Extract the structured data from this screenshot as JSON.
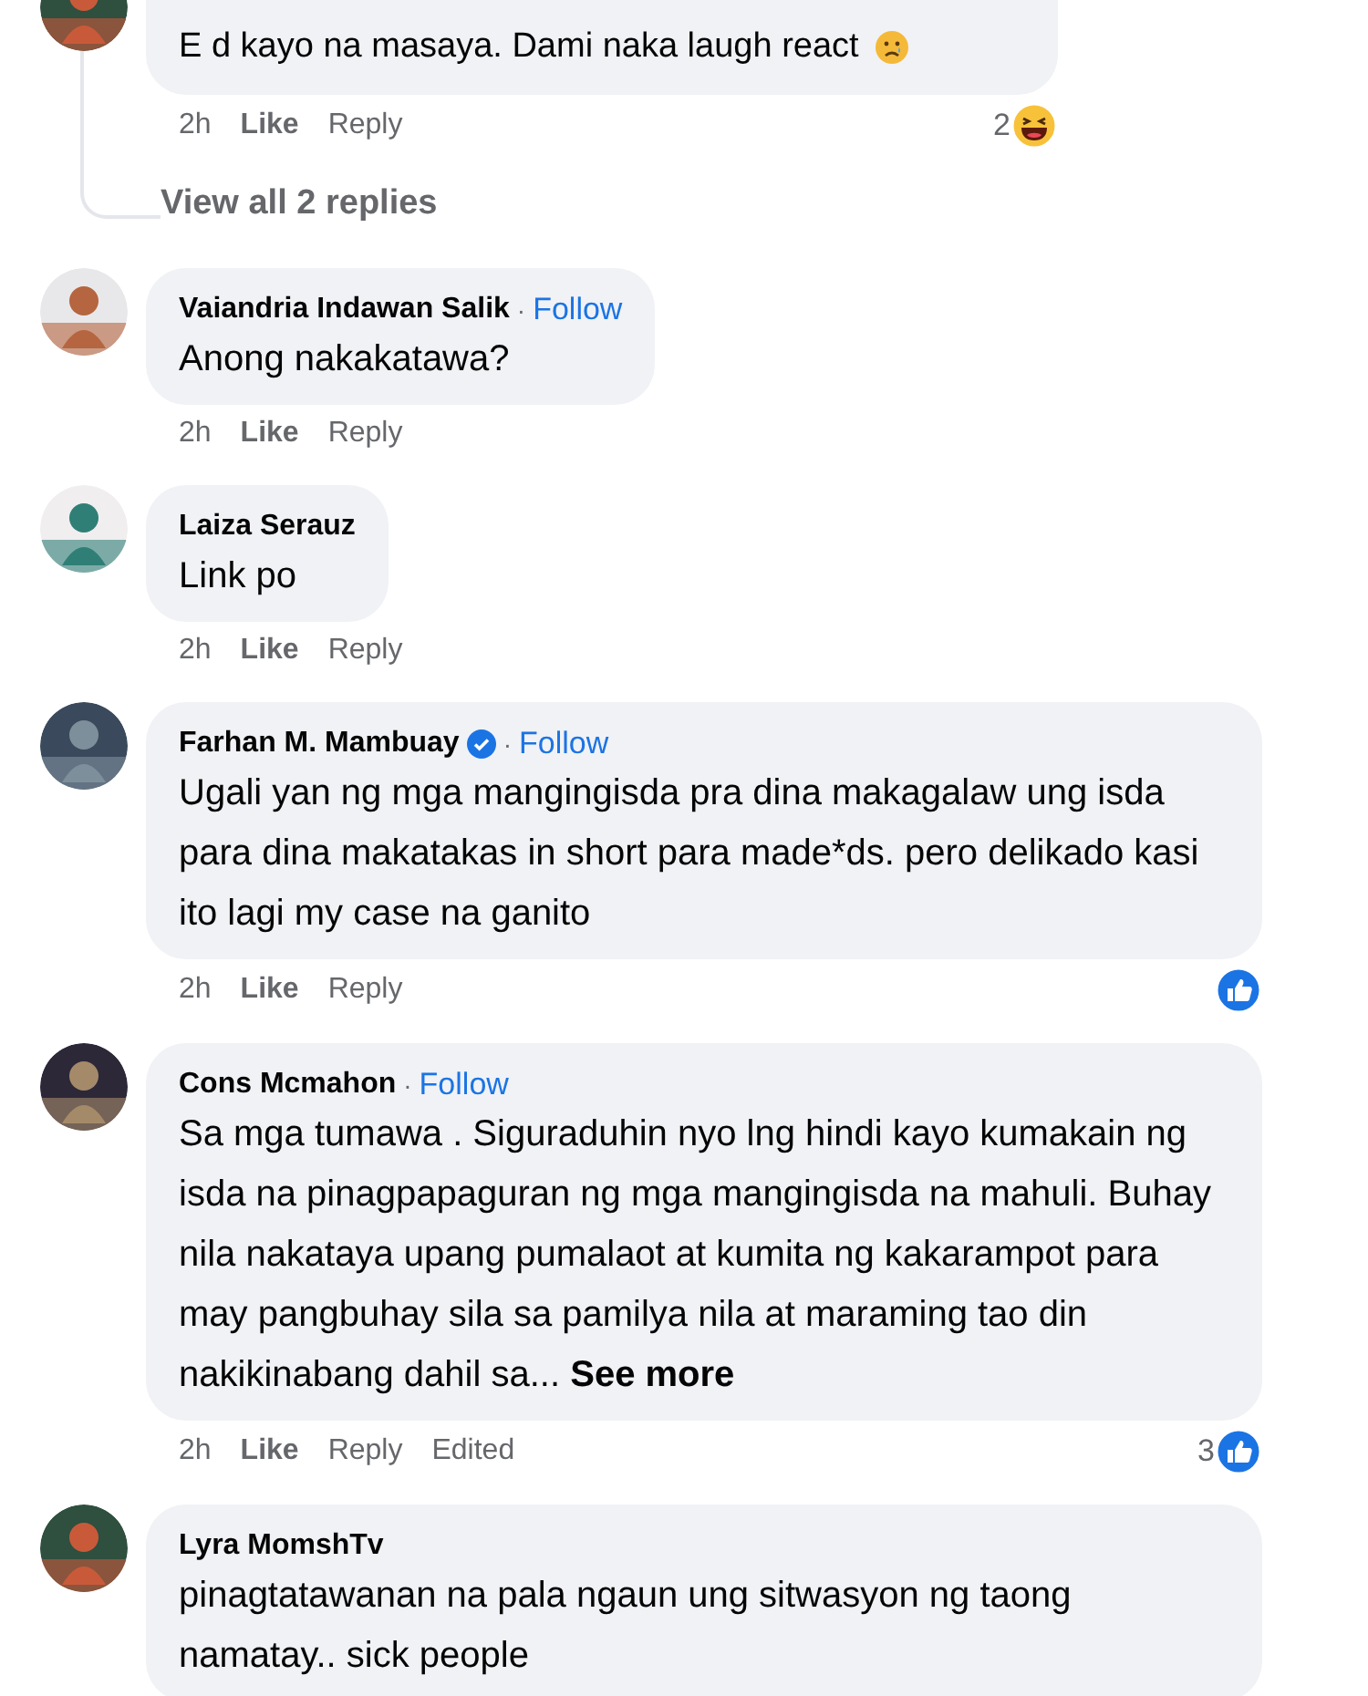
{
  "thread_reply": {
    "text": "E d kayo na masaya. Dami naka laugh react",
    "trailing_emoji": true,
    "time": "2h",
    "like": "Like",
    "reply": "Reply",
    "reaction": {
      "kind": "haha",
      "count": "2"
    }
  },
  "view_replies": "View all 2 replies",
  "comments": [
    {
      "name": "Vaiandria Indawan Salik",
      "verified": false,
      "separator": "·",
      "follow": "Follow",
      "text": "Anong nakakatawa?",
      "time": "2h",
      "like": "Like",
      "reply": "Reply"
    },
    {
      "name": "Laiza Serauz",
      "verified": false,
      "text": "Link po",
      "time": "2h",
      "like": "Like",
      "reply": "Reply"
    },
    {
      "name": "Farhan M. Mambuay",
      "verified": true,
      "separator": "·",
      "follow": "Follow",
      "text": "Ugali yan ng mga mangingisda pra dina makagalaw ung isda para dina makatakas in short para made*ds. pero delikado kasi ito lagi my case na ganito",
      "time": "2h",
      "like": "Like",
      "reply": "Reply",
      "reaction": {
        "kind": "like"
      }
    },
    {
      "name": "Cons Mcmahon",
      "verified": false,
      "separator": "·",
      "follow": "Follow",
      "text": "Sa mga tumawa . Siguraduhin nyo lng hindi kayo kumakain ng isda na pinagpapaguran ng mga mangingisda na mahuli. Buhay nila nakataya upang pumalaot at kumita ng kakarampot para may pangbuhay sila sa pamilya nila at maraming tao din nakikinabang dahil sa...",
      "see_more": "See more",
      "time": "2h",
      "like": "Like",
      "reply": "Reply",
      "edited": "Edited",
      "reaction": {
        "kind": "like",
        "count": "3"
      }
    },
    {
      "name": "Lyra MomshTv",
      "verified": false,
      "text": "pinagtatawanan na pala ngaun ung sitwasyon ng taong namatay.. sick people"
    }
  ]
}
